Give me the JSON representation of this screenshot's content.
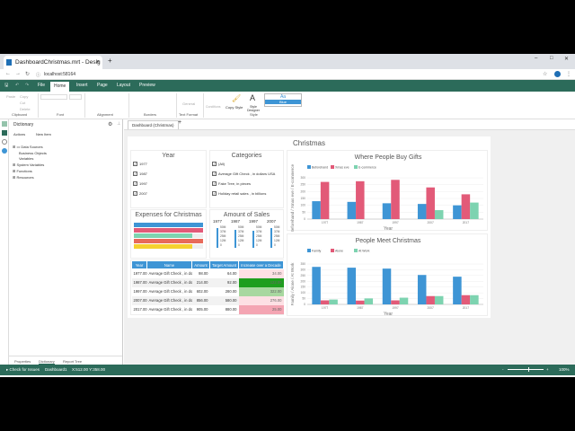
{
  "browser": {
    "tab_title": "DashboardChristmas.mrt - Desig",
    "url": "localhost:58164"
  },
  "ribbon": {
    "tabs": [
      "File",
      "Home",
      "Insert",
      "Page",
      "Layout",
      "Preview"
    ],
    "active_tab": "Home",
    "clipboard": {
      "paste": "Paste",
      "copy": "Copy",
      "cut": "Cut",
      "delete": "Delete"
    },
    "groups": [
      "Clipboard",
      "Font",
      "Alignment",
      "Borders",
      "Text Format",
      "Style"
    ],
    "text_format": "General",
    "conditions": "Conditions",
    "copy_style": "Copy Style",
    "style_designer": "Style Designer",
    "style_preview": "Aa",
    "style_name": "Blue"
  },
  "dictionary": {
    "title": "Dictionary",
    "actions": "Actions",
    "new_item": "New Item",
    "tree": [
      "Data Sources",
      "Business Objects",
      "Variables",
      "System Variables",
      "Functions",
      "Resources"
    ],
    "bottom_tabs": [
      "Properties",
      "Dictionary",
      "Report Tree"
    ]
  },
  "doc_tab": "Dashboard (Christmas)",
  "dashboard": {
    "title": "Christmas",
    "year_filter": {
      "title": "Year",
      "items": [
        "1977",
        "1987",
        "1997",
        "2007"
      ]
    },
    "categories": {
      "title": "Categories",
      "items": [
        "(All)",
        "Average Gift Check , in dollars USA",
        "Fake Tree, in pieces",
        "Holiday retail sales , in billions"
      ]
    },
    "expenses": {
      "title": "Expenses for Christmas",
      "bars": [
        {
          "color": "#3e95d5",
          "fill": 1.0
        },
        {
          "color": "#e25a78",
          "fill": 1.0
        },
        {
          "color": "#7dd3b0",
          "fill": 0.85
        },
        {
          "color": "#e86a5a",
          "fill": 1.0
        },
        {
          "color": "#f5d130",
          "fill": 0.85
        }
      ]
    },
    "sales": {
      "title": "Amount of Sales",
      "years": [
        "1977",
        "1987",
        "1997",
        "2007"
      ],
      "scale": [
        "50M",
        "37M",
        "25M",
        "12M",
        "0"
      ],
      "levels": [
        0.9,
        0.85,
        0.8,
        0.9
      ]
    },
    "table": {
      "headers": [
        "Year",
        "Name",
        "Amount",
        "Target Amount",
        "Increase over a Decade"
      ],
      "rows": [
        [
          "1977.00",
          "Average Gift Check , in dollars USA",
          "98.00",
          "64.00",
          "34.00"
        ],
        [
          "1987.00",
          "Average Gift Check , in dollars USA",
          "214.00",
          "92.00",
          "122.00"
        ],
        [
          "1997.00",
          "Average Gift Check , in dollars USA",
          "602.00",
          "280.00",
          "322.00"
        ],
        [
          "2007.00",
          "Average Gift Check , in dollars USA",
          "856.00",
          "580.00",
          "276.00"
        ],
        [
          "2017.00",
          "Average Gift Check , in dollars USA",
          "905.00",
          "880.00",
          "25.00"
        ]
      ],
      "increase_colors": [
        "#fde0e4",
        "#1e9e1e",
        "#a8d8a0",
        "#fde0e4",
        "#f4a5b3"
      ]
    }
  },
  "chart_data": [
    {
      "type": "bar",
      "title": "Where People Buy Gifts",
      "xlabel": "Year",
      "ylabel": "Beforehand / Xmas eve / E-commerce",
      "categories": [
        "1977",
        "1987",
        "1997",
        "2007",
        "2017"
      ],
      "ylim": [
        0,
        300
      ],
      "yticks": [
        0,
        50,
        100,
        150,
        200,
        250,
        300
      ],
      "legend": "top-left",
      "series": [
        {
          "name": "Beforehand",
          "color": "#3e95d5",
          "values": [
            130,
            125,
            115,
            110,
            100
          ]
        },
        {
          "name": "Xmas eve",
          "color": "#e25a78",
          "values": [
            270,
            275,
            285,
            230,
            180
          ]
        },
        {
          "name": "E-commerce",
          "color": "#7dd3b0",
          "values": [
            0,
            0,
            0,
            65,
            120
          ]
        }
      ]
    },
    {
      "type": "bar",
      "title": "People Meet Christmas",
      "xlabel": "Year",
      "ylabel": "Family / Alone / At Work",
      "categories": [
        "1977",
        "1987",
        "1997",
        "2007",
        "2017"
      ],
      "ylim": [
        0,
        350
      ],
      "yticks": [
        0,
        50,
        100,
        150,
        200,
        250,
        300,
        350
      ],
      "legend": "top-left",
      "series": [
        {
          "name": "Family",
          "color": "#3e95d5",
          "values": [
            325,
            318,
            310,
            255,
            240
          ]
        },
        {
          "name": "Alone",
          "color": "#e25a78",
          "values": [
            35,
            33,
            35,
            72,
            80
          ]
        },
        {
          "name": "At Work",
          "color": "#7dd3b0",
          "values": [
            42,
            52,
            58,
            72,
            80
          ]
        }
      ]
    }
  ],
  "status": {
    "check": "Check for Issues",
    "page": "Dashboard1",
    "coords": "X:512.00 Y:358.00",
    "zoom": "100%"
  }
}
